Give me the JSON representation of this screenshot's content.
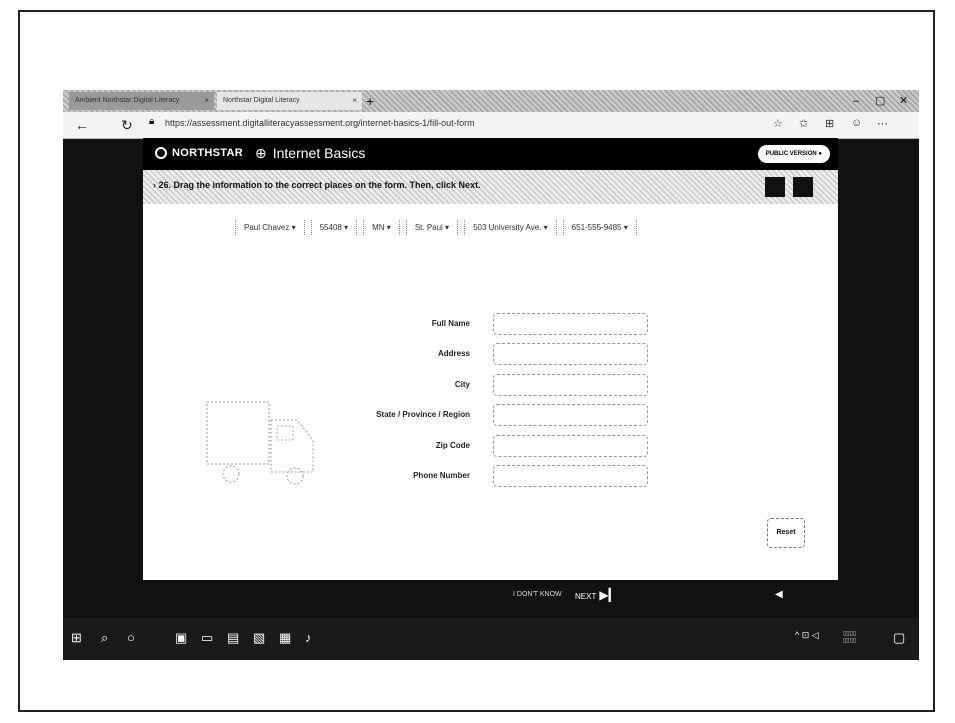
{
  "browser": {
    "tabs": [
      {
        "label": "Ambient Northstar Digital Literacy"
      },
      {
        "label": "Northstar Digital Literacy"
      }
    ],
    "new_tab": "+",
    "url": "https://assessment.digitalliteracyassessment.org/internet-basics-1/fill-out-form"
  },
  "app": {
    "logo": "NORTHSTAR",
    "module": "Internet Basics",
    "public_version": "PUBLIC VERSION",
    "instruction": "26. Drag the information to the correct places on the form. Then, click Next."
  },
  "chips": [
    "Paul Chavez",
    "55408",
    "MN",
    "St. Paul",
    "503 University Ave.",
    "651-555-9485"
  ],
  "form": {
    "fields": [
      {
        "label": "Full Name"
      },
      {
        "label": "Address"
      },
      {
        "label": "City"
      },
      {
        "label": "State / Province / Region"
      },
      {
        "label": "Zip Code"
      },
      {
        "label": "Phone Number"
      }
    ]
  },
  "reset_label": "Reset",
  "footer": {
    "dont_know": "I DON'T KNOW",
    "next": "NEXT"
  },
  "colors": {
    "header": "#000000",
    "accent": "#111111"
  }
}
